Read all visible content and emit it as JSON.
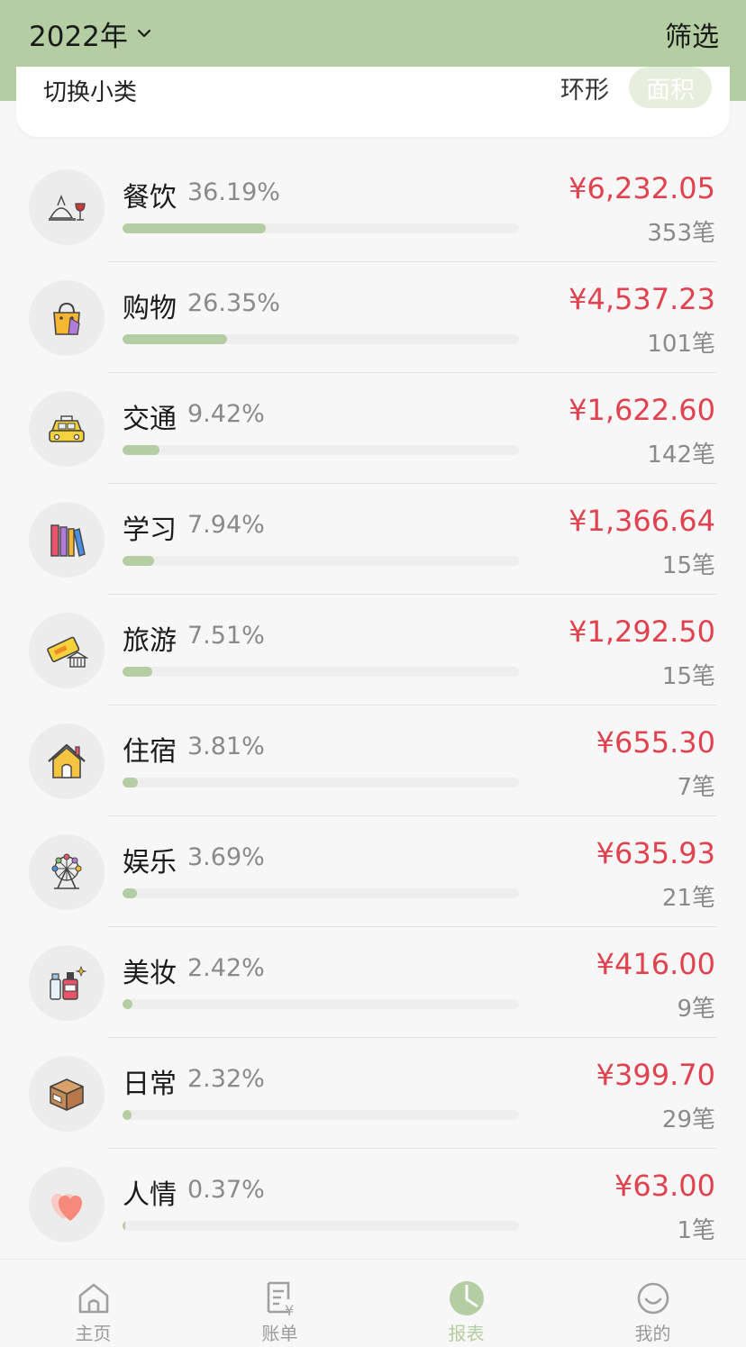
{
  "header": {
    "year": "2022年",
    "filter_label": "筛选"
  },
  "mode_bar": {
    "switch_label": "切换小类",
    "ring_label": "环形",
    "area_label": "面积"
  },
  "categories": [
    {
      "name": "餐饮",
      "percent": "36.19%",
      "amount": "¥6,232.05",
      "count": "353笔",
      "share": 0.3619,
      "icon": "dining-icon"
    },
    {
      "name": "购物",
      "percent": "26.35%",
      "amount": "¥4,537.23",
      "count": "101笔",
      "share": 0.2635,
      "icon": "shopping-bag-icon"
    },
    {
      "name": "交通",
      "percent": "9.42%",
      "amount": "¥1,622.60",
      "count": "142笔",
      "share": 0.0942,
      "icon": "taxi-icon"
    },
    {
      "name": "学习",
      "percent": "7.94%",
      "amount": "¥1,366.64",
      "count": "15笔",
      "share": 0.0794,
      "icon": "books-icon"
    },
    {
      "name": "旅游",
      "percent": "7.51%",
      "amount": "¥1,292.50",
      "count": "15笔",
      "share": 0.0751,
      "icon": "ticket-icon"
    },
    {
      "name": "住宿",
      "percent": "3.81%",
      "amount": "¥655.30",
      "count": "7笔",
      "share": 0.0381,
      "icon": "house-icon"
    },
    {
      "name": "娱乐",
      "percent": "3.69%",
      "amount": "¥635.93",
      "count": "21笔",
      "share": 0.0369,
      "icon": "ferris-wheel-icon"
    },
    {
      "name": "美妆",
      "percent": "2.42%",
      "amount": "¥416.00",
      "count": "9笔",
      "share": 0.0242,
      "icon": "cosmetics-icon"
    },
    {
      "name": "日常",
      "percent": "2.32%",
      "amount": "¥399.70",
      "count": "29笔",
      "share": 0.0232,
      "icon": "box-icon"
    },
    {
      "name": "人情",
      "percent": "0.37%",
      "amount": "¥63.00",
      "count": "1笔",
      "share": 0.0037,
      "icon": "heart-icon"
    }
  ],
  "tabs": [
    {
      "label": "主页",
      "icon": "home-icon"
    },
    {
      "label": "账单",
      "icon": "bill-icon"
    },
    {
      "label": "报表",
      "icon": "report-icon"
    },
    {
      "label": "我的",
      "icon": "profile-icon"
    }
  ],
  "colors": {
    "accent": "#b5cda2",
    "amount": "#e0424f"
  }
}
